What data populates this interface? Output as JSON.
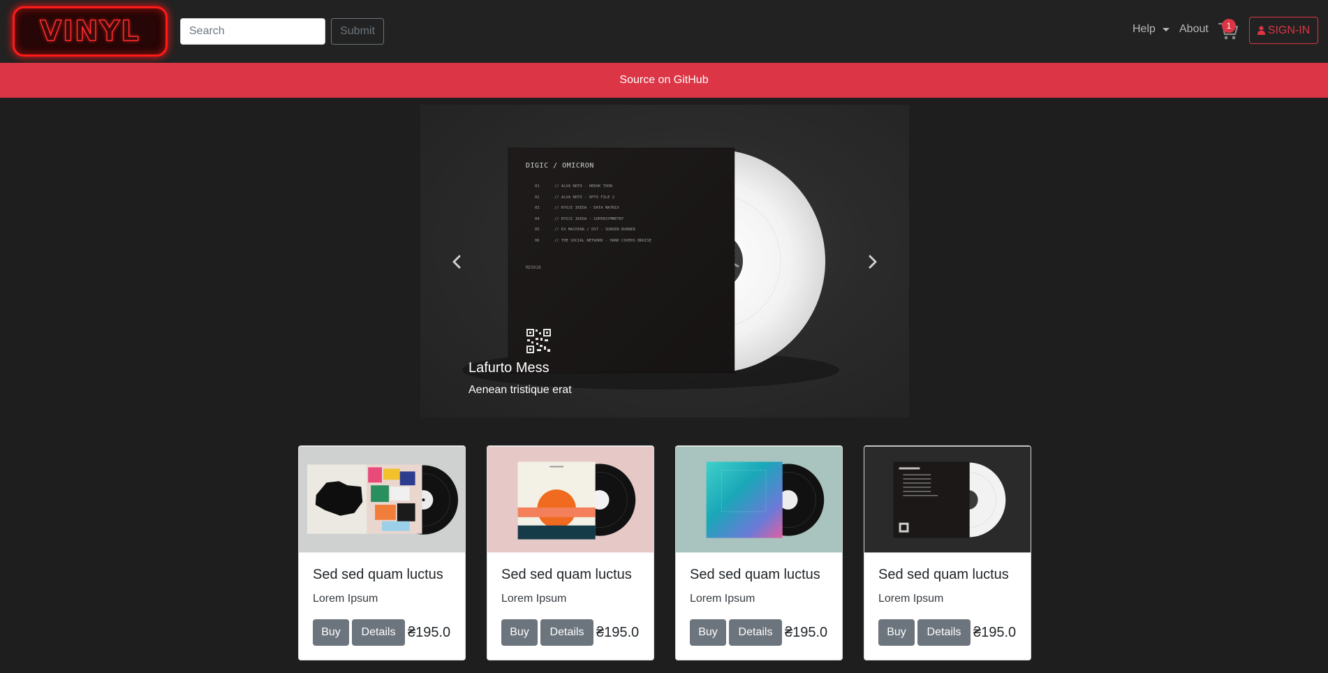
{
  "app": {
    "logo_text": "VINYL",
    "accent_color": "#dc3545"
  },
  "navbar": {
    "search_placeholder": "Search",
    "submit_label": "Submit",
    "help_label": "Help",
    "about_label": "About",
    "cart_count": "1",
    "signin_label": "SIGN-IN",
    "icons": [
      "cart-icon",
      "user-icon",
      "caret-down-icon"
    ]
  },
  "banner": {
    "text": "Source on GitHub"
  },
  "carousel": {
    "caption_title": "Lafurto Mess",
    "caption_text": "Aenean tristique erat",
    "album_label": "DIGIC / OMICRON",
    "tracks": [
      {
        "num": "01",
        "title": "// ALVA NOTO - HEROK TOON"
      },
      {
        "num": "02",
        "title": "// ALVA NOTO - OPTO FILE 2"
      },
      {
        "num": "03",
        "title": "// RYOJI IKEDA - DATA MATRIX"
      },
      {
        "num": "04",
        "title": "// RYOJI IKEDA - SUPERSYMMETRY"
      },
      {
        "num": "05",
        "title": "// EX MACHINA / OST - SUNSEN BURNER"
      },
      {
        "num": "06",
        "title": "// THE SOCIAL NETWORK - HAND COVERS BRUISE"
      }
    ],
    "catalog_code": "RES018",
    "controls": [
      "chevron-left-icon",
      "chevron-right-icon"
    ]
  },
  "products": [
    {
      "title": "Sed sed quam luctus",
      "subtitle": "Lorem Ipsum",
      "buy_label": "Buy",
      "details_label": "Details",
      "price": "₴195.0"
    },
    {
      "title": "Sed sed quam luctus",
      "subtitle": "Lorem Ipsum",
      "buy_label": "Buy",
      "details_label": "Details",
      "price": "₴195.0"
    },
    {
      "title": "Sed sed quam luctus",
      "subtitle": "Lorem Ipsum",
      "buy_label": "Buy",
      "details_label": "Details",
      "price": "₴195.0"
    },
    {
      "title": "Sed sed quam luctus",
      "subtitle": "Lorem Ipsum",
      "buy_label": "Buy",
      "details_label": "Details",
      "price": "₴195.0"
    }
  ]
}
